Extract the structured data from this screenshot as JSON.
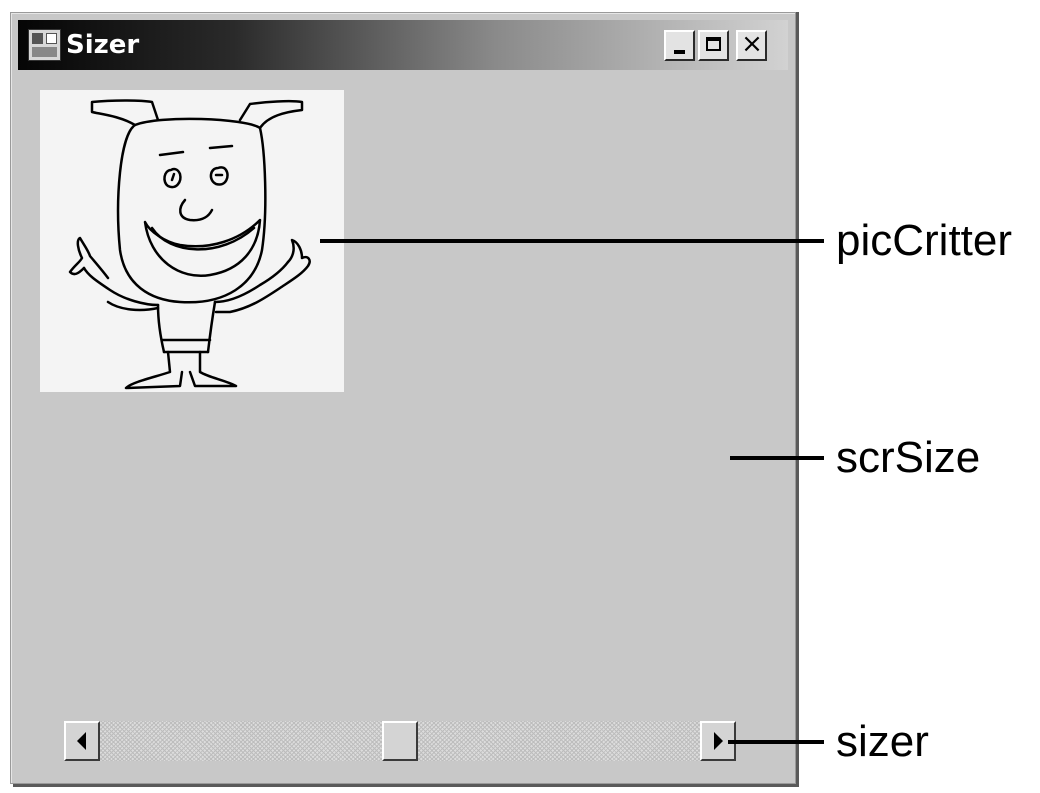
{
  "window": {
    "title": "Sizer",
    "icon": "form-app-icon",
    "caption_buttons": {
      "minimize_icon": "minimize-icon",
      "maximize_icon": "maximize-icon",
      "close_icon": "close-icon",
      "close_glyph": "×"
    }
  },
  "picture": {
    "content": "hand-drawn-critter"
  },
  "scrollbar": {
    "orientation": "horizontal",
    "left_icon": "arrow-left-icon",
    "right_icon": "arrow-right-icon",
    "thumb_position_fraction": 0.5
  },
  "callouts": {
    "pic_label": "picCritter",
    "form_label": "scrSize",
    "scroll_label": "sizer"
  },
  "colors": {
    "window_face": "#c8c8c8",
    "picture_bg": "#f4f4f4",
    "titlebar_start": "#050505",
    "titlebar_end": "#d2d2d2"
  }
}
